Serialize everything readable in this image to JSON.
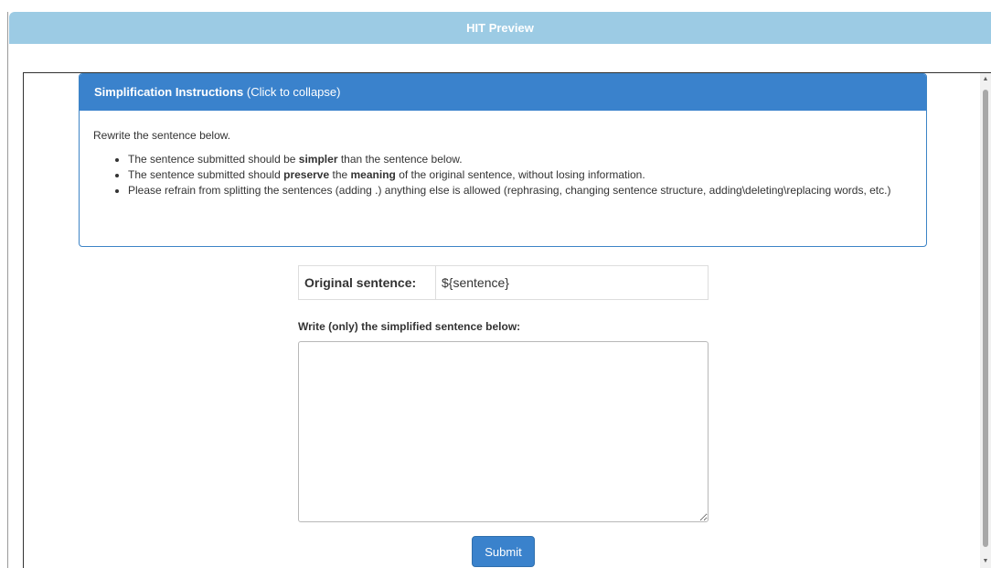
{
  "header": {
    "title": "HIT Preview"
  },
  "instructions": {
    "title": "Simplification Instructions",
    "collapse_hint": "(Click to collapse)",
    "intro": "Rewrite the sentence below.",
    "bullet1": {
      "pre": "The sentence submitted should be ",
      "bold": "simpler",
      "post": " than the sentence below."
    },
    "bullet2": {
      "pre": "The sentence submitted should ",
      "bold1": "preserve",
      "mid": " the ",
      "bold2": "meaning",
      "post": " of the original sentence, without losing information."
    },
    "bullet3": "Please refrain from splitting the sentences (adding .) anything else is allowed (rephrasing, changing sentence structure, adding\\deleting\\replacing words, etc.)"
  },
  "original": {
    "label": "Original sentence:",
    "value": "${sentence}"
  },
  "answer": {
    "label": "Write (only) the simplified sentence below:",
    "value": ""
  },
  "submit": {
    "label": "Submit"
  },
  "colors": {
    "header_bar": "#9ccbe4",
    "panel_primary": "#3a82cc",
    "text": "#333333"
  }
}
